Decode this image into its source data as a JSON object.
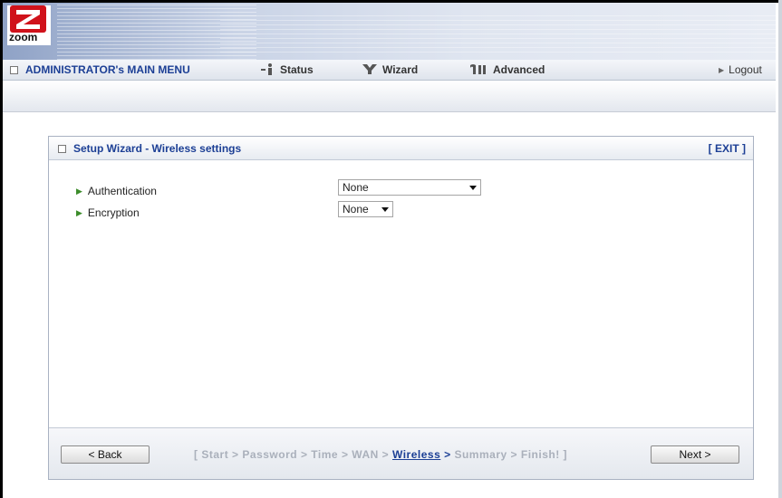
{
  "brand": {
    "logo_text": "zoom"
  },
  "menu": {
    "main": "ADMINISTRATOR's MAIN MENU",
    "status": "Status",
    "wizard": "Wizard",
    "advanced": "Advanced",
    "logout": "Logout"
  },
  "panel": {
    "title": "Setup Wizard - Wireless settings",
    "exit": "[ EXIT ]",
    "fields": {
      "authentication_label": "Authentication",
      "authentication_value": "None",
      "encryption_label": "Encryption",
      "encryption_value": "None"
    }
  },
  "footer": {
    "back": "< Back",
    "next": "Next >",
    "crumbs": {
      "open": "[",
      "start": "Start",
      "password": "Password",
      "time": "Time",
      "wan": "WAN",
      "wireless": "Wireless",
      "summary": "Summary",
      "finish": "Finish!",
      "close": "]",
      "sep": ">"
    }
  },
  "colors": {
    "brand_red": "#d0121b",
    "link_blue": "#1c3f95",
    "arrow_green": "#3c8c2a",
    "crumb_gray": "#aab0bb"
  }
}
